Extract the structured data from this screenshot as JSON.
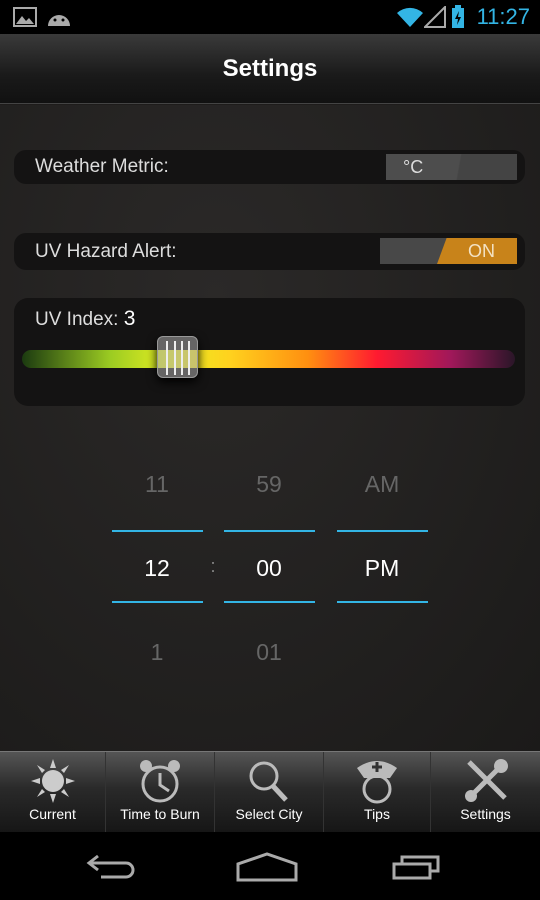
{
  "status": {
    "time": "11:27"
  },
  "header": {
    "title": "Settings"
  },
  "settings": {
    "weather_metric": {
      "label": "Weather Metric:",
      "value": "°C"
    },
    "uv_alert": {
      "label": "UV Hazard Alert:",
      "value": "ON"
    },
    "uv_index": {
      "label": "UV Index:",
      "value": "3"
    }
  },
  "time_picker": {
    "hours": [
      "11",
      "12",
      "1"
    ],
    "minutes": [
      "59",
      "00",
      "01"
    ],
    "ampm": [
      "AM",
      "PM"
    ],
    "separator": ":"
  },
  "tabs": [
    {
      "label": "Current",
      "icon": "sun-icon"
    },
    {
      "label": "Time to Burn",
      "icon": "alarm-clock-icon"
    },
    {
      "label": "Select City",
      "icon": "search-icon"
    },
    {
      "label": "Tips",
      "icon": "nurse-icon"
    },
    {
      "label": "Settings",
      "icon": "tools-icon"
    }
  ],
  "colors": {
    "accent": "#33b5e5",
    "toggle_on": "#c8831a"
  }
}
